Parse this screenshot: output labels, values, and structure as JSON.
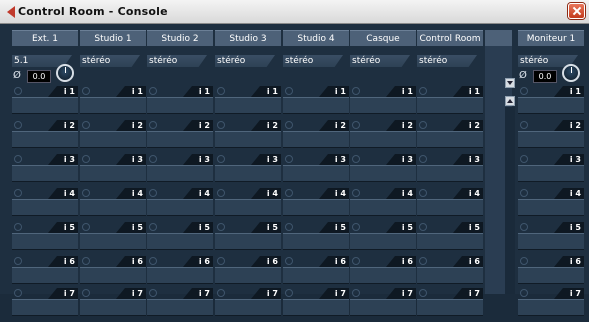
{
  "window": {
    "title": "Control Room - Console"
  },
  "columns": [
    {
      "name": "Ext. 1",
      "format": "5.1",
      "has_controls": true,
      "gain": "0.0",
      "phase_symbol": "Ø"
    },
    {
      "name": "Studio 1",
      "format": "stéréo"
    },
    {
      "name": "Studio 2",
      "format": "stéréo"
    },
    {
      "name": "Studio 3",
      "format": "stéréo"
    },
    {
      "name": "Studio 4",
      "format": "stéréo"
    },
    {
      "name": "Casque",
      "format": "stéréo"
    },
    {
      "name": "Control Room",
      "format": "stéréo"
    }
  ],
  "monitor_column": {
    "name": "Moniteur 1",
    "format": "stéréo",
    "gain": "0.0",
    "phase_symbol": "Ø"
  },
  "insert_slots": [
    "i 1",
    "i 2",
    "i 3",
    "i 4",
    "i 5",
    "i 6",
    "i 7"
  ],
  "colors": {
    "background": "#1e2f40",
    "header": "#4d6178",
    "slot_field": "#2d4155",
    "close": "#c23a1c"
  }
}
